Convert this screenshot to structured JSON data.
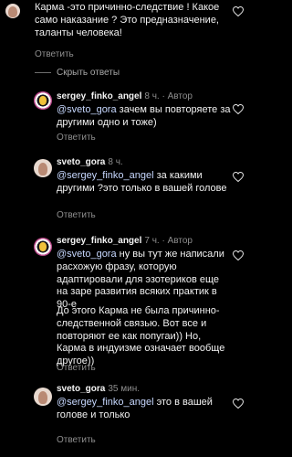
{
  "top_comment": {
    "text": "Карма -это причинно-следствие ! Какое само наказание ? Это предназначение, таланты человека!",
    "reply_label": "Ответить"
  },
  "collapse_label": "Скрыть ответы",
  "replies": [
    {
      "username": "sergey_finko_angel",
      "time": "8 ч.",
      "author_badge": "Автор",
      "mention": "@sveto_gora",
      "text": "зачем вы повторяете за другими одно и тоже)",
      "reply_label": "Ответить"
    },
    {
      "username": "sveto_gora",
      "time": "8 ч.",
      "author_badge": "",
      "mention": "@sergey_finko_angel",
      "text": "за какими другими ?это только в вашей голове",
      "reply_label": "Ответить"
    },
    {
      "username": "sergey_finko_angel",
      "time": "7 ч.",
      "author_badge": "Автор",
      "mention": "@sveto_gora",
      "text": "ну вы тут же написали расхожую фразу, которую адаптировали для эзотериков еще на заре развития всяких практик в 90-е",
      "text2": "До этого Карма не была причинно-следственной связью. Вот все и повторяют ее как попугаи)) Но, Карма в индуизме означает вообще другое))",
      "reply_label": "Ответить"
    },
    {
      "username": "sveto_gora",
      "time": "35 мин.",
      "author_badge": "",
      "mention": "@sergey_finko_angel",
      "text": "это в вашей голове и только",
      "reply_label": "Ответить"
    }
  ],
  "icons": {
    "like": "heart-outline-icon"
  }
}
